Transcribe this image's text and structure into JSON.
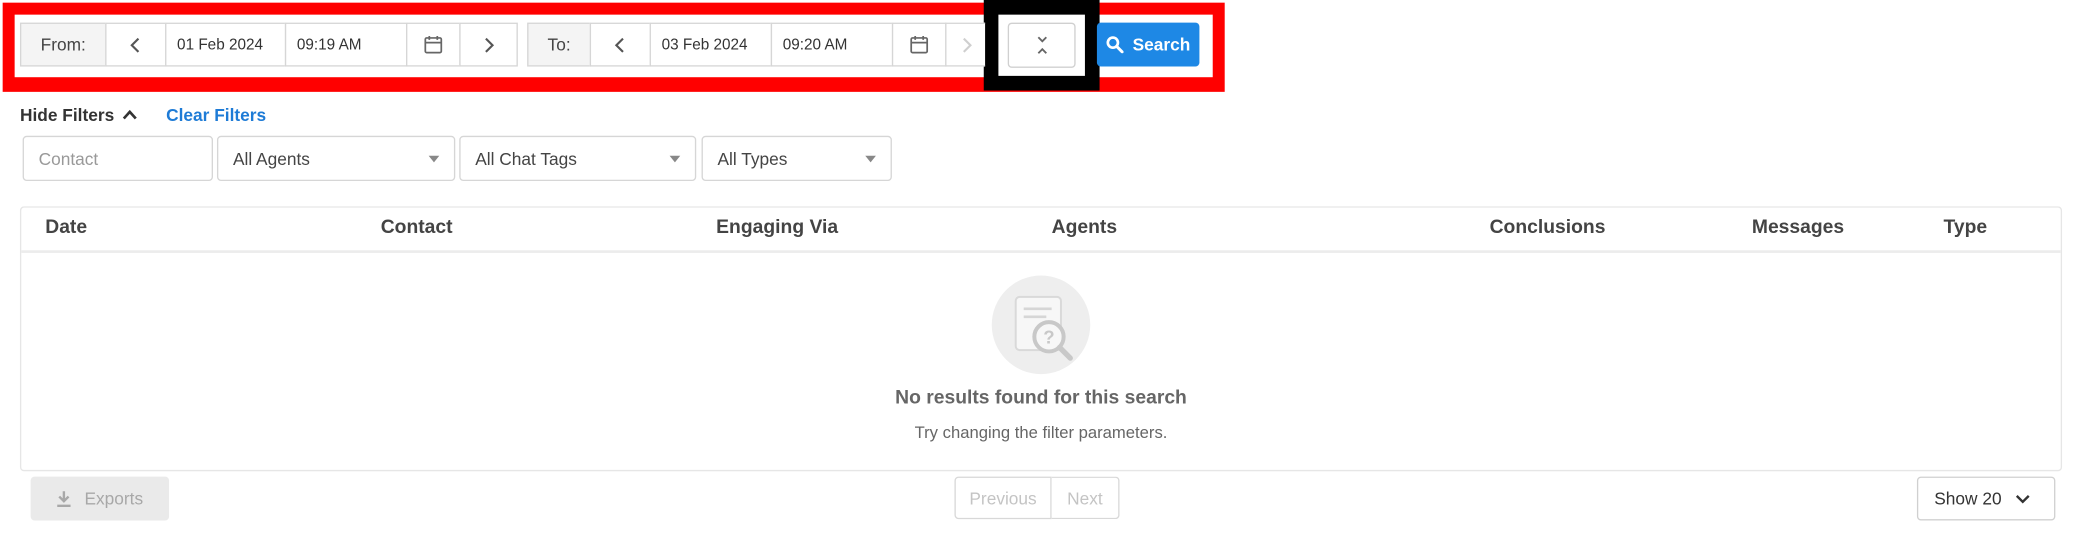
{
  "date_range": {
    "from_label": "From:",
    "from_date": "01 Feb 2024",
    "from_time": "09:19 AM",
    "to_label": "To:",
    "to_date": "03 Feb 2024",
    "to_time": "09:20 AM",
    "search_label": "Search"
  },
  "filters": {
    "hide_label": "Hide Filters",
    "clear_label": "Clear Filters",
    "contact_placeholder": "Contact",
    "agents_value": "All Agents",
    "chat_tags_value": "All Chat Tags",
    "types_value": "All Types"
  },
  "table": {
    "columns": [
      "Date",
      "Contact",
      "Engaging Via",
      "Agents",
      "Conclusions",
      "Messages",
      "Type"
    ],
    "empty_title": "No results found for this search",
    "empty_subtitle": "Try changing the filter parameters."
  },
  "footer": {
    "exports_label": "Exports",
    "previous_label": "Previous",
    "next_label": "Next",
    "page_size_label": "Show 20"
  },
  "colors": {
    "accent": "#1e88e5",
    "highlight_outer": "#ff0000",
    "highlight_inner": "#000000"
  }
}
